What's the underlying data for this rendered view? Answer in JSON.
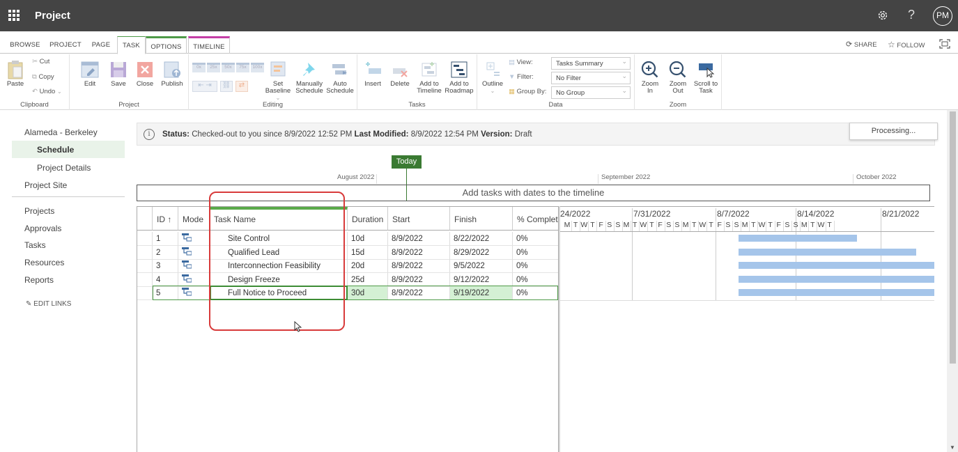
{
  "suitebar": {
    "app_title": "Project",
    "help_label": "?",
    "avatar_initials": "PM"
  },
  "tabs": [
    {
      "label": "BROWSE"
    },
    {
      "label": "PROJECT"
    },
    {
      "label": "PAGE"
    },
    {
      "label": "TASK",
      "active": true
    },
    {
      "label": "OPTIONS"
    },
    {
      "label": "TIMELINE"
    }
  ],
  "actions": {
    "share": "SHARE",
    "follow": "FOLLOW"
  },
  "ribbon": {
    "clipboard": {
      "label": "Clipboard",
      "paste": "Paste",
      "cut": "Cut",
      "copy": "Copy",
      "undo": "Undo"
    },
    "project": {
      "label": "Project",
      "edit": "Edit",
      "save": "Save",
      "close": "Close",
      "publish": "Publish"
    },
    "editing": {
      "label": "Editing",
      "set_baseline_1": "Set",
      "set_baseline_2": "Baseline",
      "manual_1": "Manually",
      "manual_2": "Schedule",
      "auto_1": "Auto",
      "auto_2": "Schedule",
      "pct": [
        "0x",
        "25x",
        "50x",
        "75x",
        "100x"
      ]
    },
    "tasks": {
      "label": "Tasks",
      "insert": "Insert",
      "delete": "Delete",
      "add_tl_1": "Add to",
      "add_tl_2": "Timeline",
      "add_rm_1": "Add to",
      "add_rm_2": "Roadmap"
    },
    "data": {
      "label": "Data",
      "outline": "Outline",
      "view_label": "View:",
      "view_value": "Tasks Summary",
      "filter_label": "Filter:",
      "filter_value": "No Filter",
      "group_label": "Group By:",
      "group_value": "No Group"
    },
    "zoom": {
      "label": "Zoom",
      "zoom_in_1": "Zoom",
      "zoom_in_2": "In",
      "zoom_out_1": "Zoom",
      "zoom_out_2": "Out",
      "scroll_1": "Scroll to",
      "scroll_2": "Task"
    }
  },
  "nav": {
    "project_name": "Alameda - Berkeley",
    "schedule": "Schedule",
    "project_details": "Project Details",
    "project_site": "Project Site",
    "projects": "Projects",
    "approvals": "Approvals",
    "tasks": "Tasks",
    "resources": "Resources",
    "reports": "Reports",
    "edit_links": "EDIT LINKS"
  },
  "status": {
    "status_label": "Status:",
    "status_value": "Checked-out to you since 8/9/2022 12:52 PM",
    "modified_label": "Last Modified:",
    "modified_value": "8/9/2022 12:54 PM",
    "version_label": "Version:",
    "version_value": "Draft",
    "processing": "Processing..."
  },
  "timeline": {
    "today": "Today",
    "months": [
      "August 2022",
      "September 2022",
      "October 2022"
    ],
    "placeholder": "Add tasks with dates to the timeline"
  },
  "grid": {
    "headers": {
      "id": "ID ↑",
      "mode": "Mode",
      "name": "Task Name",
      "duration": "Duration",
      "start": "Start",
      "finish": "Finish",
      "pct": "% Complete"
    },
    "rows": [
      {
        "id": "1",
        "name": "Site Control",
        "duration": "10d",
        "start": "8/9/2022",
        "finish": "8/22/2022",
        "pct": "0%"
      },
      {
        "id": "2",
        "name": "Qualified Lead",
        "duration": "15d",
        "start": "8/9/2022",
        "finish": "8/29/2022",
        "pct": "0%"
      },
      {
        "id": "3",
        "name": "Interconnection Feasibility",
        "duration": "20d",
        "start": "8/9/2022",
        "finish": "9/5/2022",
        "pct": "0%"
      },
      {
        "id": "4",
        "name": "Design Freeze",
        "duration": "25d",
        "start": "8/9/2022",
        "finish": "9/12/2022",
        "pct": "0%"
      },
      {
        "id": "5",
        "name": "Full Notice to Proceed",
        "duration": "30d",
        "start": "8/9/2022",
        "finish": "9/19/2022",
        "pct": "0%"
      }
    ]
  },
  "gantt": {
    "weeks": [
      "24/2022",
      "7/31/2022",
      "8/7/2022",
      "8/14/2022",
      "8/21/2022"
    ],
    "days": [
      "M",
      "T",
      "W",
      "T",
      "F",
      "S",
      "S",
      "M",
      "T",
      "W",
      "T",
      "F",
      "S",
      "S",
      "M",
      "T",
      "W",
      "T",
      "F",
      "S",
      "S",
      "M",
      "T",
      "W",
      "T",
      "F",
      "S",
      "S",
      "M",
      "T",
      "W",
      "T"
    ]
  },
  "colors": {
    "suitebar": "#444444",
    "accent_green": "#3a7a32",
    "bar_blue": "#a5c5ea",
    "annotation_red": "#d83a3a"
  }
}
